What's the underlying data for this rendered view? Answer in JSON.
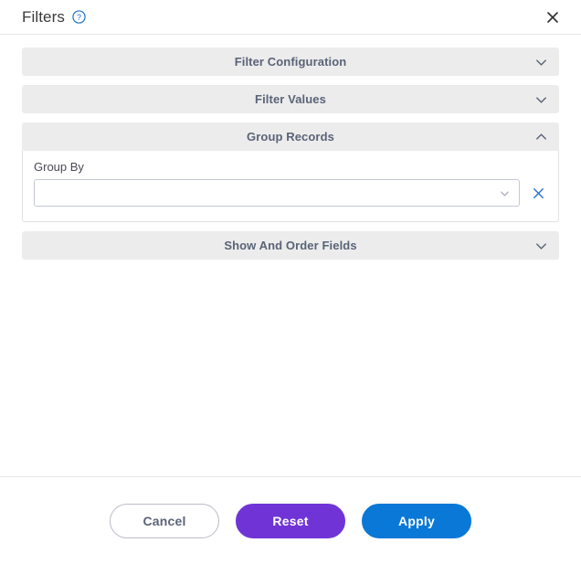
{
  "header": {
    "title": "Filters",
    "help_icon": "help-circle-icon",
    "close_icon": "close-icon"
  },
  "sections": [
    {
      "title": "Filter Configuration",
      "expanded": false,
      "chevron_icon": "chevron-down-icon"
    },
    {
      "title": "Filter Values",
      "expanded": false,
      "chevron_icon": "chevron-down-icon"
    },
    {
      "title": "Group Records",
      "expanded": true,
      "chevron_icon": "chevron-up-icon"
    },
    {
      "title": "Show And Order Fields",
      "expanded": false,
      "chevron_icon": "chevron-down-icon"
    }
  ],
  "group_records": {
    "group_by_label": "Group By",
    "group_by_value": "",
    "group_by_placeholder": "",
    "dropdown_icon": "chevron-down-icon",
    "clear_icon": "close-icon"
  },
  "footer": {
    "cancel_label": "Cancel",
    "reset_label": "Reset",
    "apply_label": "Apply"
  },
  "colors": {
    "accent_blue": "#0a78d6",
    "accent_purple": "#7034d6",
    "header_grey": "#ececec",
    "title_text": "#5a6377",
    "link_blue": "#1a73c8"
  }
}
